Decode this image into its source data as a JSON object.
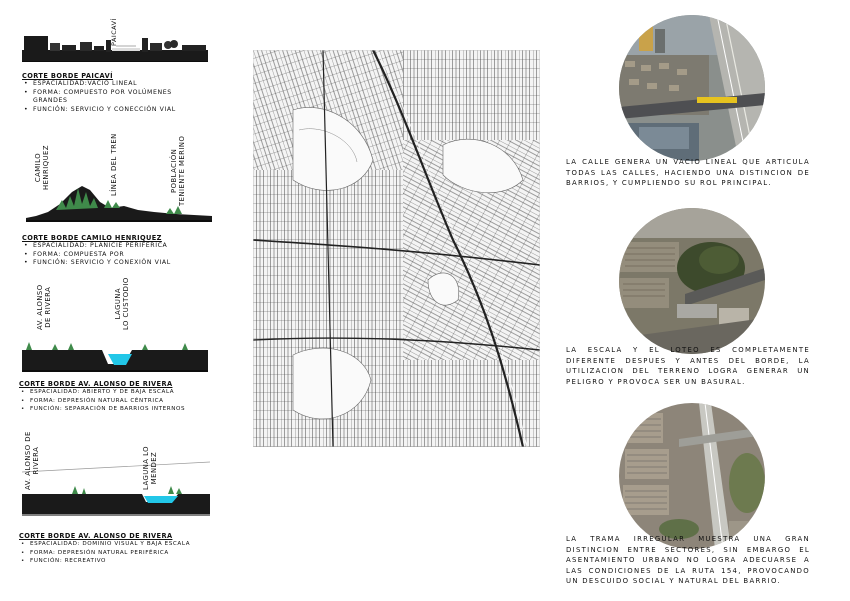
{
  "sections": [
    {
      "title": "CORTE BORDE PAICAVÍ",
      "labels": [
        "PAICAVÍ"
      ],
      "bullets": [
        "ESPACIALIDAD:VACÍO LINEAL",
        "FORMA: COMPUESTO POR VOLÚMENES GRANDES",
        "FUNCIÓN: SERVICIO Y CONECCIÓN VIAL"
      ]
    },
    {
      "title": "CORTE BORDE CAMILO HENRIQUEZ",
      "labels": [
        "CAMILO\nHENRIQUEZ",
        "LÍNEA DEL TREN",
        "POBLACIÓN\nTENIENTE MERINO"
      ],
      "bullets": [
        "ESPACIALIDAD: PLANICIE PERIFÉRICA",
        "FORMA: COMPUESTA POR",
        "FUNCIÓN: SERVICIO Y CONEXIÓN VIAL"
      ]
    },
    {
      "title": "CORTE BORDE AV. ALONSO DE RIVERA",
      "labels": [
        "AV. ALONSO\nDE RIVERA",
        "LAGUNA\nLO CUSTODIO"
      ],
      "bullets": [
        "ESPACIALIDAD: ABIERTO Y DE BAJA ESCALA",
        "FORMA: DEPRESIÓN NATURAL CÉNTRICA",
        "FUNCIÓN: SEPARACIÓN DE BARRIOS INTERNOS"
      ]
    },
    {
      "title": "CORTE BORDE AV. ALONSO DE RIVERA",
      "labels": [
        "AV. ALONSO DE\nRIVERA",
        "LAGUNA LO\nMENDEZ"
      ],
      "bullets": [
        "ESPACIALIDAD: DOMINIO VISUAL Y BAJA ESCALA",
        "FORMA: DEPRESIÓN NATURAL PERIFÉRICA",
        "FUNCIÓN: RECREATIVO"
      ]
    }
  ],
  "descriptions": [
    "La calle genera un vacio lineal que articula todas las calles, haciendo una distincion de barrios, y cumpliendo su rol principal.",
    "La escala y el loteo es completamente diferente despues y antes del borde, la utilizacion del terreno logra generar un peligro y provoca ser un basural.",
    "La trama irregular muestra una gran distincion entre sectores, sin embargo el asentamiento urbano no logra adecuarse a las condiciones de la ruta 154, provocando un descuido social y natural del barrio."
  ],
  "colors": {
    "vegetation": "#3f8a4a",
    "water": "#22c7e8",
    "ground": "#1a1a1a"
  }
}
